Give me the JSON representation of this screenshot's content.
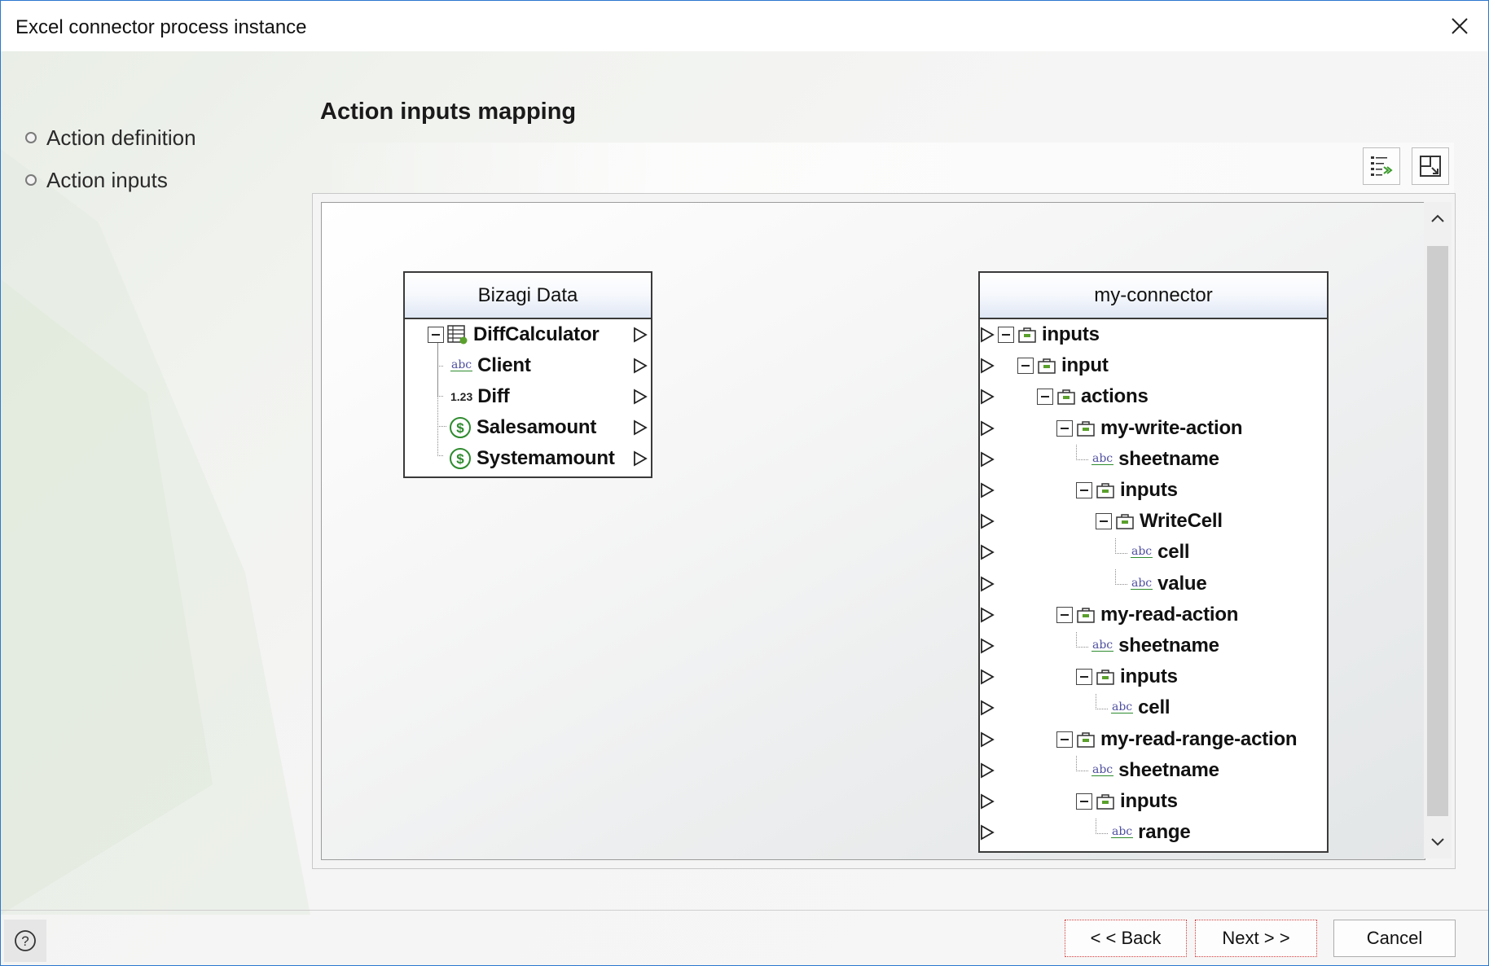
{
  "window": {
    "title": "Excel connector process instance"
  },
  "nav": {
    "items": [
      {
        "label": "Action definition"
      },
      {
        "label": "Action inputs"
      }
    ]
  },
  "main": {
    "section_title": "Action inputs mapping"
  },
  "toolbar": {
    "icons": [
      "auto-map-icon",
      "fit-view-icon"
    ]
  },
  "left_box": {
    "title": "Bizagi Data",
    "rows": [
      {
        "label": "DiffCalculator",
        "icon": "entity-table-icon"
      },
      {
        "label": "Client",
        "icon": "string-type-icon"
      },
      {
        "label": "Diff",
        "icon": "number-type-icon"
      },
      {
        "label": "Salesamount",
        "icon": "currency-type-icon"
      },
      {
        "label": "Systemamount",
        "icon": "currency-type-icon"
      }
    ]
  },
  "right_box": {
    "title": "my-connector",
    "rows": [
      {
        "label": "inputs",
        "icon": "object-icon"
      },
      {
        "label": "input",
        "icon": "object-icon"
      },
      {
        "label": "actions",
        "icon": "object-icon"
      },
      {
        "label": "my-write-action",
        "icon": "object-icon"
      },
      {
        "label": "sheetname",
        "icon": "string-type-icon"
      },
      {
        "label": "inputs",
        "icon": "object-icon"
      },
      {
        "label": "WriteCell",
        "icon": "object-icon"
      },
      {
        "label": "cell",
        "icon": "string-type-icon"
      },
      {
        "label": "value",
        "icon": "string-type-icon"
      },
      {
        "label": "my-read-action",
        "icon": "object-icon"
      },
      {
        "label": "sheetname",
        "icon": "string-type-icon"
      },
      {
        "label": "inputs",
        "icon": "object-icon"
      },
      {
        "label": "cell",
        "icon": "string-type-icon"
      },
      {
        "label": "my-read-range-action",
        "icon": "object-icon"
      },
      {
        "label": "sheetname",
        "icon": "string-type-icon"
      },
      {
        "label": "inputs",
        "icon": "object-icon"
      },
      {
        "label": "range",
        "icon": "string-type-icon"
      }
    ]
  },
  "type_icons": {
    "abc": "abc",
    "num": "1.23"
  },
  "footer": {
    "back": "< < Back",
    "next": "Next > >",
    "cancel": "Cancel",
    "help_icon": "help-icon"
  }
}
